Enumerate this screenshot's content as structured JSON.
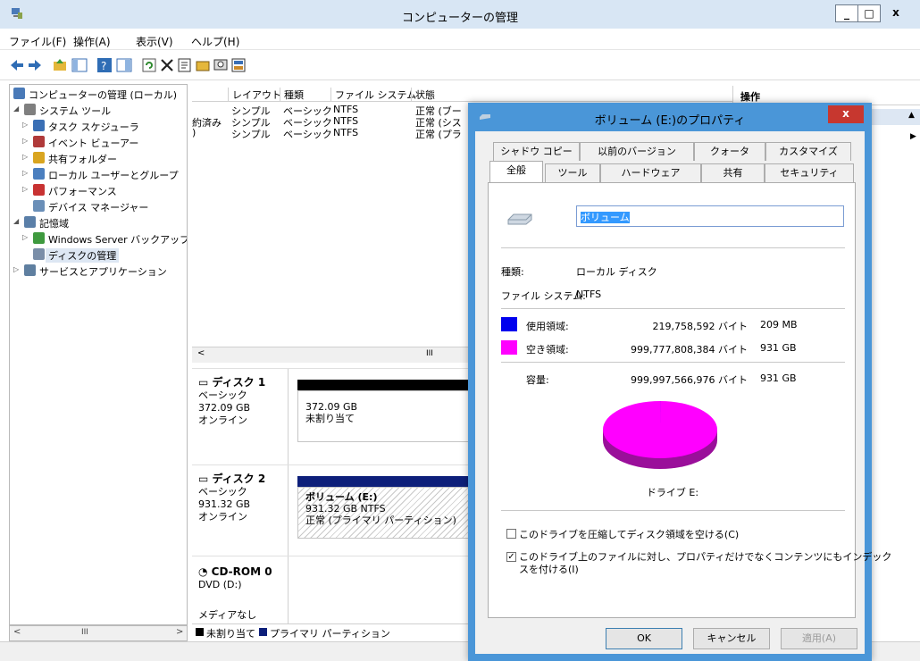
{
  "window": {
    "title": "コンピューターの管理",
    "min": "_",
    "max": "□",
    "close": "x"
  },
  "menu": [
    "ファイル(F)",
    "操作(A)",
    "表示(V)",
    "ヘルプ(H)"
  ],
  "toolbar_icons": [
    "back-icon",
    "forward-icon",
    "up-folder-icon",
    "show-hide-tree-icon",
    "help-icon",
    "console-icon",
    "refresh-icon",
    "delete-icon",
    "properties-icon",
    "open-icon",
    "search-icon",
    "help-topic-icon"
  ],
  "tree": {
    "items": [
      {
        "label": "コンピューターの管理 (ローカル)",
        "level": 0,
        "toggle": "",
        "icon_color": "#4a7ab8"
      },
      {
        "label": "システム ツール",
        "level": 1,
        "toggle": "◢",
        "icon_color": "#7f7f7f"
      },
      {
        "label": "タスク スケジューラ",
        "level": 2,
        "toggle": "▷",
        "icon_color": "#3a6fb5"
      },
      {
        "label": "イベント ビューアー",
        "level": 2,
        "toggle": "▷",
        "icon_color": "#b03a3a"
      },
      {
        "label": "共有フォルダー",
        "level": 2,
        "toggle": "▷",
        "icon_color": "#d9a520"
      },
      {
        "label": "ローカル ユーザーとグループ",
        "level": 2,
        "toggle": "▷",
        "icon_color": "#4b7fbf"
      },
      {
        "label": "パフォーマンス",
        "level": 2,
        "toggle": "▷",
        "icon_color": "#c83232"
      },
      {
        "label": "デバイス マネージャー",
        "level": 2,
        "toggle": "",
        "icon_color": "#6a8fb8"
      },
      {
        "label": "記憶域",
        "level": 1,
        "toggle": "◢",
        "icon_color": "#5a7fa8"
      },
      {
        "label": "Windows Server バックアップ",
        "level": 2,
        "toggle": "▷",
        "icon_color": "#3f9a3f"
      },
      {
        "label": "ディスクの管理",
        "level": 2,
        "toggle": "",
        "icon_color": "#7a8ea8",
        "selected": true
      },
      {
        "label": "サービスとアプリケーション",
        "level": 1,
        "toggle": "▷",
        "icon_color": "#5f7fa0"
      }
    ]
  },
  "volume_list": {
    "headers": [
      "レイアウト",
      "種類",
      "ファイル システム",
      "状態"
    ],
    "rows": [
      {
        "name": "",
        "layout": "シンプル",
        "type": "ベーシック",
        "fs": "NTFS",
        "status": "正常 (ブー"
      },
      {
        "name": "約済み",
        "layout": "シンプル",
        "type": "ベーシック",
        "fs": "NTFS",
        "status": "正常 (シス"
      },
      {
        "name": ")",
        "layout": "シンプル",
        "type": "ベーシック",
        "fs": "NTFS",
        "status": "正常 (プラ"
      }
    ]
  },
  "disks": [
    {
      "title": "ディスク 1",
      "kind": "ベーシック",
      "size": "372.09 GB",
      "state": "オンライン",
      "part_size": "372.09 GB",
      "part_status": "未割り当て"
    },
    {
      "title": "ディスク 2",
      "kind": "ベーシック",
      "size": "931.32 GB",
      "state": "オンライン",
      "part_name": "ボリューム (E:)",
      "part_size": "931.32 GB NTFS",
      "part_status": "正常 (プライマリ パーティション)"
    },
    {
      "title": "CD-ROM 0",
      "kind": "DVD (D:)",
      "state": "メディアなし"
    }
  ],
  "legend": {
    "unallocated": "未割り当て",
    "primary": "プライマリ パーティション"
  },
  "operations": {
    "header": "操作"
  },
  "dialog": {
    "title": "ボリューム (E:)のプロパティ",
    "close": "x",
    "tabs_back": [
      "シャドウ コピー",
      "以前のバージョン",
      "クォータ",
      "カスタマイズ"
    ],
    "tabs_front": [
      "全般",
      "ツール",
      "ハードウェア",
      "共有",
      "セキュリティ"
    ],
    "volume_label": "ボリューム",
    "type_label": "種類:",
    "type_value": "ローカル ディスク",
    "fs_label": "ファイル システム:",
    "fs_value": "NTFS",
    "used_label": "使用領域:",
    "used_bytes": "219,758,592 バイト",
    "used_size": "209 MB",
    "free_label": "空き領域:",
    "free_bytes": "999,777,808,384 バイト",
    "free_size": "931 GB",
    "capacity_label": "容量:",
    "capacity_bytes": "999,997,566,976 バイト",
    "capacity_size": "931 GB",
    "drive_label": "ドライブ E:",
    "compress_label": "このドライブを圧縮してディスク領域を空ける(C)",
    "compress_checked": false,
    "index_label_1": "このドライブ上のファイルに対し、プロパティだけでなくコンテンツにもインデック",
    "index_label_2": "スを付ける(I)",
    "index_checked": true,
    "ok": "OK",
    "cancel": "キャンセル",
    "apply": "適用(A)",
    "colors": {
      "used": "#0000ee",
      "free": "#ff00ff"
    },
    "usage_fraction_used": 0.0002
  }
}
